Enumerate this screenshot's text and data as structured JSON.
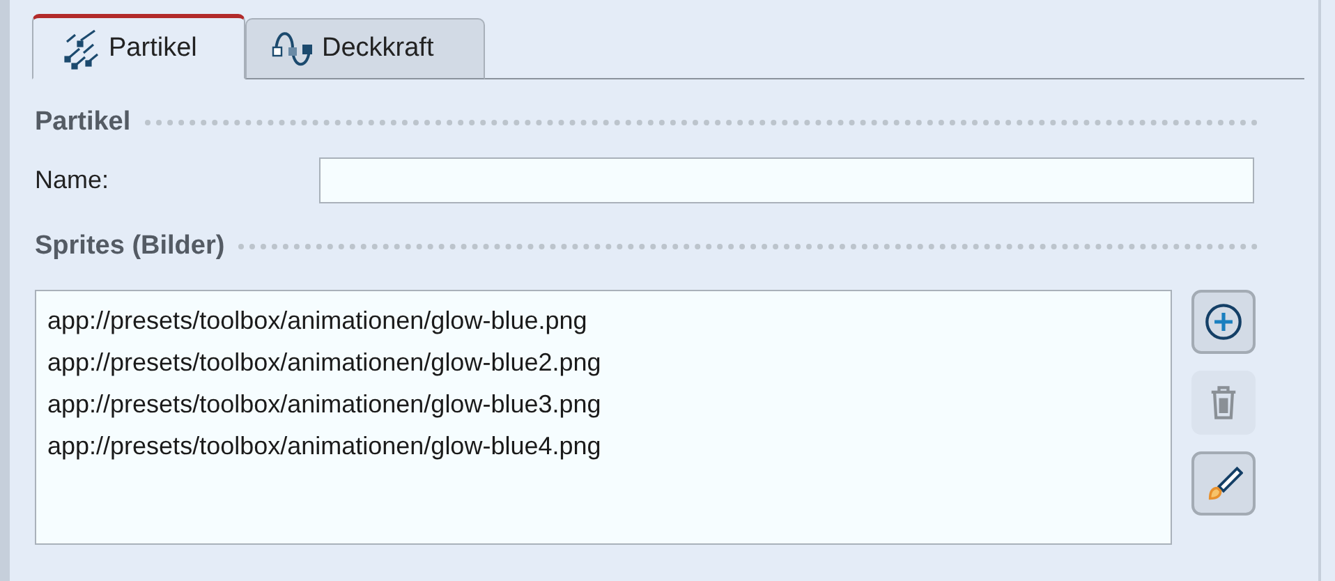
{
  "tabs": [
    {
      "label": "Partikel",
      "kind": "particles",
      "selected": true
    },
    {
      "label": "Deckkraft",
      "kind": "opacity",
      "selected": false
    }
  ],
  "sections": [
    {
      "title": "Partikel"
    },
    {
      "title": "Sprites (Bilder)"
    }
  ],
  "name_field": {
    "label": "Name:"
  },
  "sprites": [
    "app://presets/toolbox/animationen/glow-blue.png",
    "app://presets/toolbox/animationen/glow-blue2.png",
    "app://presets/toolbox/animationen/glow-blue3.png",
    "app://presets/toolbox/animationen/glow-blue4.png"
  ],
  "buttons": [
    {
      "kind": "add",
      "disabled": false
    },
    {
      "kind": "delete",
      "disabled": true
    },
    {
      "kind": "edit",
      "disabled": false
    }
  ]
}
